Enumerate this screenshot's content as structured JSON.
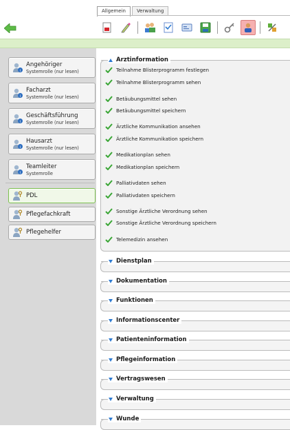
{
  "tabs": [
    {
      "label": "Allgemein",
      "active": true
    },
    {
      "label": "Verwaltung",
      "active": false
    }
  ],
  "toolbar": {
    "icons": [
      "pdf-document-icon",
      "pen-edit-icon",
      "users-group-icon",
      "checklist-icon",
      "id-card-icon",
      "save-disk-icon",
      "key-icon",
      "roles-active-icon",
      "tools-icon"
    ]
  },
  "colors": {
    "green_strip": "#dcefc9",
    "left_panel": "#d9d9d9",
    "check_green": "#3aa635",
    "expander_blue": "#2e7bd1",
    "selected_border": "#7cc04f"
  },
  "roles": [
    {
      "name": "Angehöriger",
      "sub": "Systemrolle (nur lesen)",
      "icon": "system-role-icon"
    },
    {
      "name": "Facharzt",
      "sub": "Systemrolle (nur lesen)",
      "icon": "system-role-icon"
    },
    {
      "name": "Geschäftsführung",
      "sub": "Systemrolle (nur lesen)",
      "icon": "system-role-icon"
    },
    {
      "name": "Hausarzt",
      "sub": "Systemrolle (nur lesen)",
      "icon": "system-role-icon"
    },
    {
      "name": "Teamleiter",
      "sub": "Systemrolle",
      "icon": "system-role-icon"
    },
    {
      "name": "PDL",
      "sub": "",
      "icon": "user-key-icon",
      "selected": true
    },
    {
      "name": "Pflegefachkraft",
      "sub": "",
      "icon": "user-key-icon"
    },
    {
      "name": "Pflegehelfer",
      "sub": "",
      "icon": "user-key-icon"
    }
  ],
  "groups": [
    {
      "title": "Arztinformation",
      "expanded": true,
      "permissions": [
        "Teilnahme Blisterprogramm festlegen",
        "Teilnahme Blisterprogramm sehen",
        "Betäubungsmittel sehen",
        "Betäubungsmittel speichern",
        "Ärztliche Kommunikation ansehen",
        "Ärztliche Kommunikation speichern",
        "Medikationplan sehen",
        "Medikationplan speichern",
        "Palliativdaten sehen",
        "Palliativdaten speichern",
        "Sonstige Ärztliche Verordnung sehen",
        "Sonstige Ärztliche Verordnung speichern",
        "Telemedizin ansehen"
      ]
    },
    {
      "title": "Dienstplan",
      "expanded": false
    },
    {
      "title": "Dokumentation",
      "expanded": false
    },
    {
      "title": "Funktionen",
      "expanded": false
    },
    {
      "title": "Informationscenter",
      "expanded": false
    },
    {
      "title": "Patienteninformation",
      "expanded": false
    },
    {
      "title": "Pflegeinformation",
      "expanded": false
    },
    {
      "title": "Vertragswesen",
      "expanded": false
    },
    {
      "title": "Verwaltung",
      "expanded": false
    },
    {
      "title": "Wunde",
      "expanded": false
    }
  ]
}
